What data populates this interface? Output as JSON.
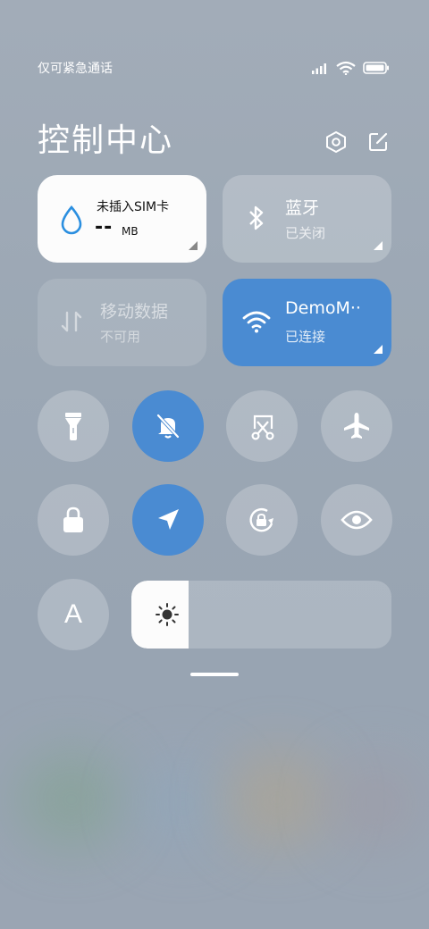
{
  "status_bar": {
    "carrier": "仅可紧急通话"
  },
  "header": {
    "title": "控制中心"
  },
  "cards": {
    "sim": {
      "label": "未插入SIM卡",
      "dash": "--",
      "unit": "MB"
    },
    "bluetooth": {
      "label": "蓝牙",
      "status": "已关闭"
    },
    "mobile_data": {
      "label": "移动数据",
      "status": "不可用"
    },
    "wifi": {
      "label": "DemoM··",
      "status": "已连接"
    }
  },
  "toggles": [
    {
      "icon": "flashlight-icon",
      "active": false
    },
    {
      "icon": "mute-bell-icon",
      "active": true
    },
    {
      "icon": "screenshot-icon",
      "active": false
    },
    {
      "icon": "airplane-icon",
      "active": false
    },
    {
      "icon": "lock-icon",
      "active": false
    },
    {
      "icon": "location-icon",
      "active": true
    },
    {
      "icon": "rotation-lock-icon",
      "active": false
    },
    {
      "icon": "eye-icon",
      "active": false
    }
  ],
  "auto_brightness": {
    "letter": "A"
  },
  "brightness": {
    "level": 0.22
  },
  "colors": {
    "accent": "#4a8bd2",
    "card_white": "#fcfcfc"
  }
}
